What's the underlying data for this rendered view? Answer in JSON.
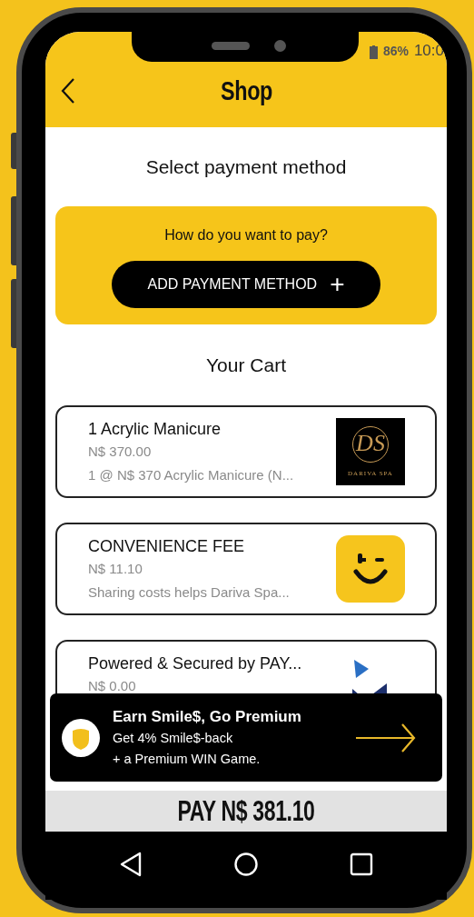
{
  "status_bar": {
    "battery": "86%",
    "time": "10:0"
  },
  "header": {
    "title": "Shop"
  },
  "payment": {
    "heading": "Select payment method",
    "prompt": "How do you want to pay?",
    "button": {
      "label": "ADD PAYMENT METHOD",
      "icon": "+"
    }
  },
  "cart": {
    "heading": "Your Cart",
    "items": [
      {
        "kind": "spa",
        "title": "1 Acrylic Manicure",
        "price": "N$ 370.00",
        "detail": "1 @ N$ 370 Acrylic Manicure (N...",
        "logo": {
          "monogram": "DS",
          "caption": "DARIVA SPA"
        }
      },
      {
        "kind": "smile",
        "title": "CONVENIENCE FEE",
        "price": "N$ 11.10",
        "detail": "Sharing costs helps Dariva Spa..."
      },
      {
        "kind": "check",
        "title": "Powered & Secured by PAY...",
        "price": "N$ 0.00"
      }
    ]
  },
  "promo": {
    "title": "Earn Smile$, Go Premium",
    "lines": [
      "Get 4% Smile$-back",
      "+ a Premium WIN Game."
    ]
  },
  "pay_button": {
    "label": "PAY N$ 381.10"
  }
}
